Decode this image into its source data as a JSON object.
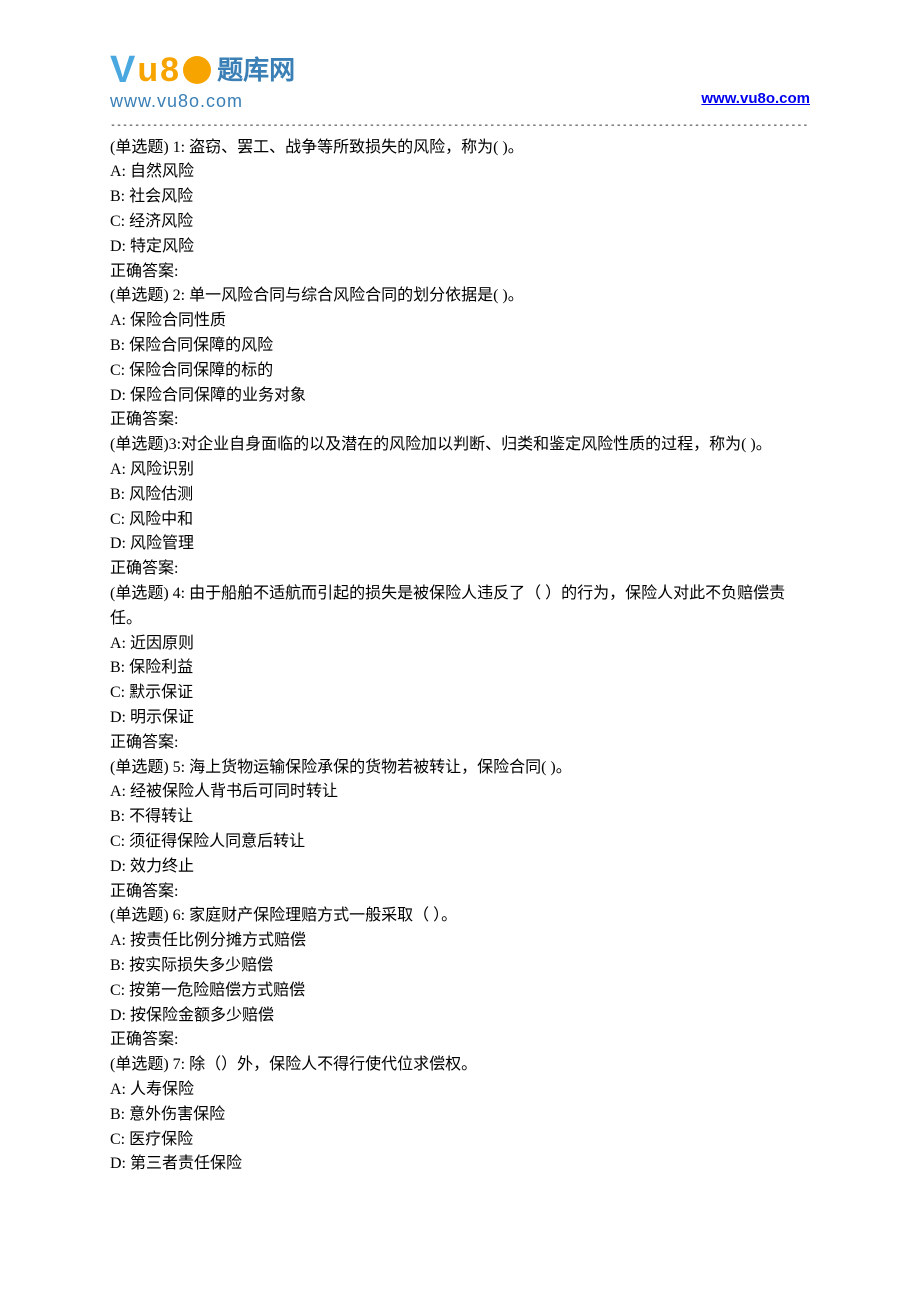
{
  "header": {
    "logo_brand": "题库网",
    "logo_url_text": "www.vu8o.com",
    "link_text": "www.vu8o.com"
  },
  "divider": "--------------------------------------------------------------------------------------------------------------------------------",
  "questions": [
    {
      "stem": "(单选题) 1: 盗窃、罢工、战争等所致损失的风险，称为( )。",
      "options": [
        "A: 自然风险",
        "B: 社会风险",
        "C: 经济风险",
        "D: 特定风险"
      ],
      "answer_label": "正确答案:"
    },
    {
      "stem": "(单选题) 2: 单一风险合同与综合风险合同的划分依据是( )。",
      "options": [
        "A: 保险合同性质",
        "B: 保险合同保障的风险",
        "C: 保险合同保障的标的",
        "D: 保险合同保障的业务对象"
      ],
      "answer_label": "正确答案:"
    },
    {
      "stem": "(单选题)3:对企业自身面临的以及潜在的风险加以判断、归类和鉴定风险性质的过程，称为( )。",
      "options": [
        "A: 风险识别",
        "B: 风险估测",
        "C: 风险中和",
        "D: 风险管理"
      ],
      "answer_label": "正确答案:"
    },
    {
      "stem": "(单选题) 4: 由于船舶不适航而引起的损失是被保险人违反了（   ）的行为，保险人对此不负赔偿责任。",
      "options": [
        "A: 近因原则",
        "B: 保险利益",
        "C: 默示保证",
        "D: 明示保证"
      ],
      "answer_label": "正确答案:"
    },
    {
      "stem": "(单选题) 5: 海上货物运输保险承保的货物若被转让，保险合同( )。",
      "options": [
        "A: 经被保险人背书后可同时转让",
        "B: 不得转让",
        "C: 须征得保险人同意后转让",
        "D: 效力终止"
      ],
      "answer_label": "正确答案:"
    },
    {
      "stem": "(单选题) 6: 家庭财产保险理赔方式一般采取（   ）。",
      "options": [
        "A: 按责任比例分摊方式赔偿",
        "B: 按实际损失多少赔偿",
        "C: 按第一危险赔偿方式赔偿",
        "D: 按保险金额多少赔偿"
      ],
      "answer_label": "正确答案:"
    },
    {
      "stem": "(单选题) 7: 除（）外，保险人不得行使代位求偿权。",
      "options": [
        "A: 人寿保险",
        "B: 意外伤害保险",
        "C: 医疗保险",
        "D: 第三者责任保险"
      ],
      "answer_label": ""
    }
  ]
}
